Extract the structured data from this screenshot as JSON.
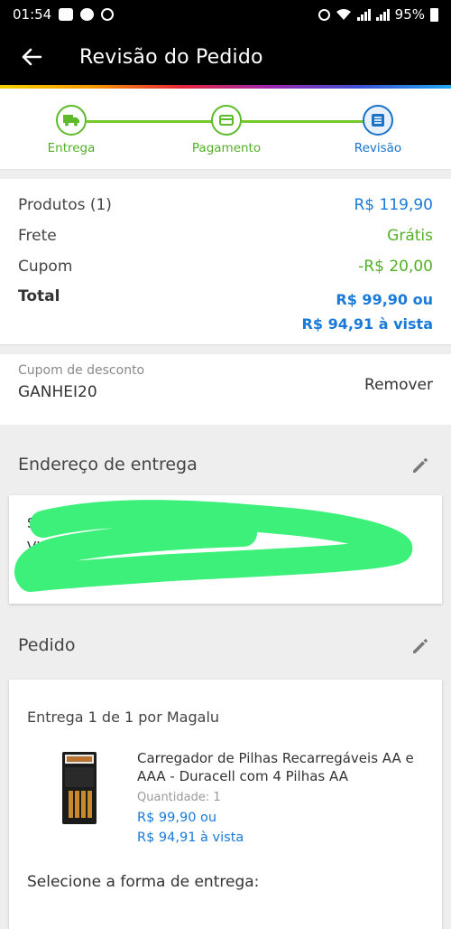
{
  "status_bar": {
    "time": "01:54",
    "battery": "95%"
  },
  "app_bar": {
    "title": "Revisão do Pedido"
  },
  "stepper": {
    "steps": [
      {
        "label": "Entrega",
        "icon": "truck-icon",
        "state": "done"
      },
      {
        "label": "Pagamento",
        "icon": "card-icon",
        "state": "done"
      },
      {
        "label": "Revisão",
        "icon": "list-icon",
        "state": "current"
      }
    ]
  },
  "summary": {
    "products_label": "Produtos (1)",
    "products_value": "R$ 119,90",
    "shipping_label": "Frete",
    "shipping_value": "Grátis",
    "coupon_label": "Cupom",
    "coupon_value": "-R$ 20,00",
    "total_label": "Total",
    "total_value_line1": "R$ 99,90 ou",
    "total_value_line2": "R$ 94,91 à vista"
  },
  "coupon": {
    "caption": "Cupom de desconto",
    "code": "GANHEI20",
    "remove_label": "Remover"
  },
  "address": {
    "heading": "Endereço de entrega",
    "line1": "SA",
    "line2": "VILA"
  },
  "order": {
    "heading": "Pedido",
    "carrier": "Entrega 1 de 1 por Magalu",
    "product": {
      "name": "Carregador de Pilhas Recarregáveis AA e AAA - Duracell com 4 Pilhas AA",
      "quantity": "Quantidade: 1",
      "price_line1": "R$ 99,90 ou",
      "price_line2": "R$ 94,91 à vista"
    },
    "select_delivery": "Selecione a forma de entrega:"
  },
  "colors": {
    "accent_blue": "#1a7ad8",
    "accent_green": "#52b026",
    "highlight_scribble": "#3cf07a"
  }
}
